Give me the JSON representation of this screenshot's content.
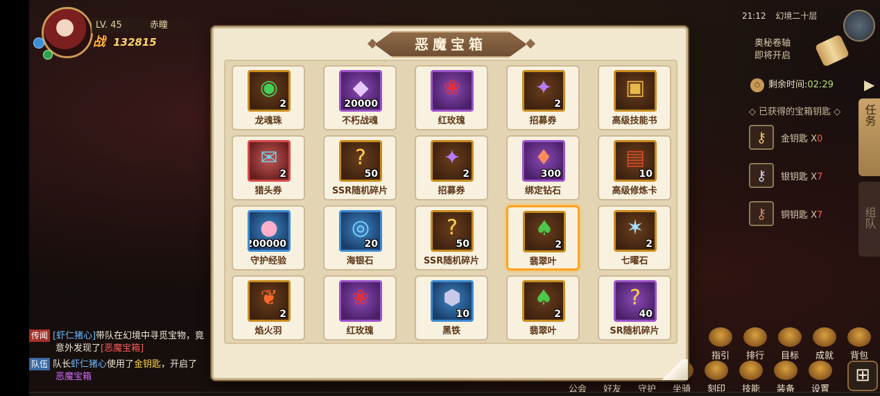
{
  "player": {
    "level": "LV. 45",
    "name": "赤瞳",
    "power_glyph": "战",
    "power": "132815"
  },
  "status": {
    "clock": "21:12",
    "floor": "幻境二十层"
  },
  "side_panel": {
    "scroll_note_line1": "奥秘卷轴",
    "scroll_note_line2": "即将开启",
    "timer_label": "剩余时间:",
    "timer_value": "02:29",
    "keys_title": "已获得的宝箱钥匙",
    "keys": [
      {
        "label": "金钥匙 X",
        "count": "0"
      },
      {
        "label": "银钥匙 X",
        "count": "7"
      },
      {
        "label": "铜钥匙 X",
        "count": "7"
      }
    ],
    "tab_task": "任务",
    "tab_team": "组队"
  },
  "modal": {
    "title": "恶魔宝箱",
    "items": [
      {
        "name": "龙魂珠",
        "count": "2",
        "icon": "dragon-pearl-icon",
        "glyph": "◉",
        "glyph_color": "#43d05a",
        "frame": "gold"
      },
      {
        "name": "不朽战魂",
        "count": "20000",
        "icon": "soul-icon",
        "glyph": "◆",
        "glyph_color": "#e6c8ff",
        "frame": "purple"
      },
      {
        "name": "红玫瑰",
        "count": "",
        "icon": "rose-icon",
        "glyph": "❀",
        "glyph_color": "#e0303a",
        "frame": "purple"
      },
      {
        "name": "招募券",
        "count": "2",
        "icon": "ticket-icon",
        "glyph": "✦",
        "glyph_color": "#b47cff",
        "frame": "gold"
      },
      {
        "name": "高级技能书",
        "count": "",
        "icon": "book-icon",
        "glyph": "▣",
        "glyph_color": "#e8b84a",
        "frame": "gold"
      },
      {
        "name": "猎头券",
        "count": "2",
        "icon": "hunter-ticket-icon",
        "glyph": "✉",
        "glyph_color": "#6fd2e8",
        "frame": "red"
      },
      {
        "name": "SSR随机碎片",
        "count": "50",
        "icon": "fragment-icon",
        "glyph": "?",
        "glyph_color": "#ffd24a",
        "frame": "gold"
      },
      {
        "name": "招募券",
        "count": "2",
        "icon": "ticket-icon",
        "glyph": "✦",
        "glyph_color": "#b47cff",
        "frame": "gold"
      },
      {
        "name": "绑定钻石",
        "count": "300",
        "icon": "diamond-icon",
        "glyph": "♦",
        "glyph_color": "#ff8a5a",
        "frame": "purple"
      },
      {
        "name": "高级修炼卡",
        "count": "10",
        "icon": "card-icon",
        "glyph": "▤",
        "glyph_color": "#d64a2a",
        "frame": "gold"
      },
      {
        "name": "守护经验",
        "count": "200000",
        "icon": "exp-icon",
        "glyph": "●",
        "glyph_color": "#ffb0c8",
        "frame": "blue"
      },
      {
        "name": "海银石",
        "count": "20",
        "icon": "sea-silver-icon",
        "glyph": "◎",
        "glyph_color": "#7fd8ff",
        "frame": "blue"
      },
      {
        "name": "SSR随机碎片",
        "count": "50",
        "icon": "fragment-icon",
        "glyph": "?",
        "glyph_color": "#ffd24a",
        "frame": "gold"
      },
      {
        "name": "翡翠叶",
        "count": "2",
        "icon": "jade-leaf-icon",
        "glyph": "♠",
        "glyph_color": "#4cc84a",
        "frame": "gold",
        "selected": true
      },
      {
        "name": "七曜石",
        "count": "2",
        "icon": "star-stone-icon",
        "glyph": "✶",
        "glyph_color": "#a8e0ff",
        "frame": "gold"
      },
      {
        "name": "焰火羽",
        "count": "2",
        "icon": "flame-feather-icon",
        "glyph": "❦",
        "glyph_color": "#ff6a2a",
        "frame": "gold"
      },
      {
        "name": "红玫瑰",
        "count": "",
        "icon": "rose-icon",
        "glyph": "❀",
        "glyph_color": "#e0303a",
        "frame": "purple"
      },
      {
        "name": "黑铁",
        "count": "10",
        "icon": "iron-icon",
        "glyph": "⬢",
        "glyph_color": "#c8c8e8",
        "frame": "blue"
      },
      {
        "name": "翡翠叶",
        "count": "2",
        "icon": "jade-leaf-icon",
        "glyph": "♠",
        "glyph_color": "#4cc84a",
        "frame": "gold"
      },
      {
        "name": "SR随机碎片",
        "count": "40",
        "icon": "fragment-icon",
        "glyph": "?",
        "glyph_color": "#ffd24a",
        "frame": "purple"
      }
    ]
  },
  "chat": {
    "rumor_tag": "传闻",
    "rumor_nick": "[虾仁猪心]",
    "rumor_text1": "带队在幻境中寻觅宝物，竟",
    "rumor_text2": "意外发现了",
    "rumor_item": "[恶魔宝箱]",
    "team_tag": "队伍",
    "team_text1": "队长",
    "team_nick": "虾仁猪心",
    "team_text2": "使用了",
    "team_key": "金钥匙",
    "team_text3": "，开启了",
    "team_item": "恶魔宝箱"
  },
  "menu_top": [
    "指引",
    "排行",
    "目标",
    "成就",
    "背包"
  ],
  "menu_bottom": [
    "公会",
    "好友",
    "守护",
    "坐骑",
    "刻印",
    "技能",
    "装备",
    "设置"
  ]
}
